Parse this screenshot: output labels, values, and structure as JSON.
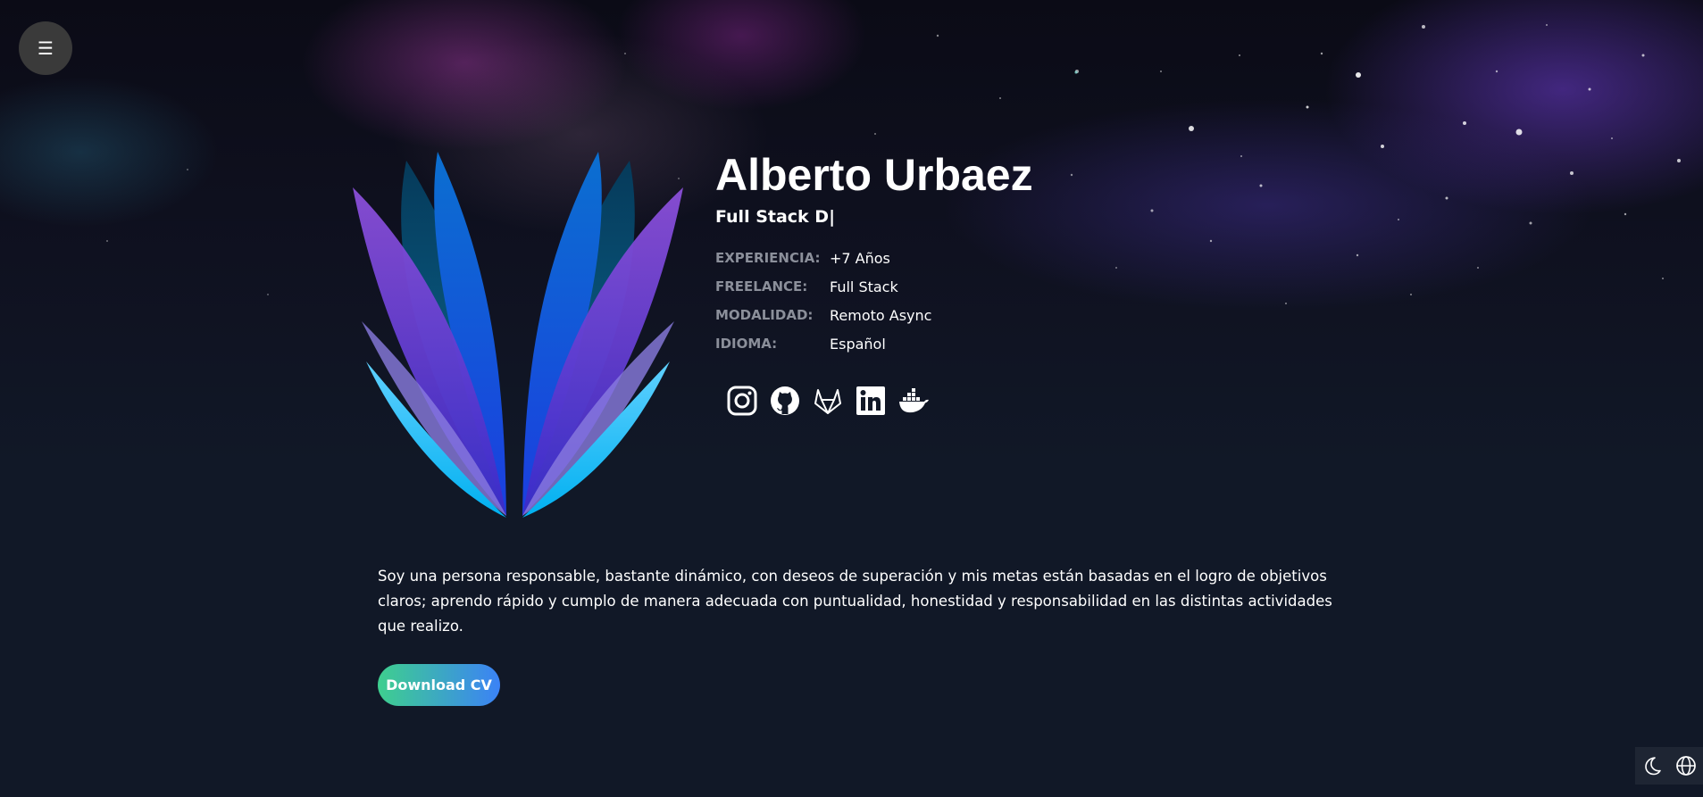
{
  "menu": {
    "icon": "hamburger-menu-icon",
    "glyph": "☰"
  },
  "profile": {
    "name": "Alberto Urbaez",
    "role_typed": "Full Stack D|",
    "details": [
      {
        "label": "EXPERIENCIA:",
        "value": "+7 Años"
      },
      {
        "label": "FREELANCE:",
        "value": "Full Stack"
      },
      {
        "label": "MODALIDAD:",
        "value": "Remoto Async"
      },
      {
        "label": "IDIOMA:",
        "value": "Español"
      }
    ],
    "social_icons": [
      "instagram-icon",
      "github-icon",
      "gitlab-icon",
      "linkedin-icon",
      "docker-icon"
    ]
  },
  "about": {
    "bio": "Soy una persona responsable, bastante dinámico, con deseos de superación y mis metas están basadas en el logro de objetivos claros; aprendo rápido y cumplo de manera adecuada con puntualidad, honestidad y responsabilidad en las distintas actividades que realizo.",
    "download_label": "Download CV"
  },
  "controls": {
    "icons": [
      "moon-icon",
      "globe-icon"
    ]
  },
  "colors": {
    "background": "#111827",
    "button_gradient_start": "#3ecf8e",
    "button_gradient_end": "#3b82f6",
    "label_gray": "#8b8f9a"
  }
}
